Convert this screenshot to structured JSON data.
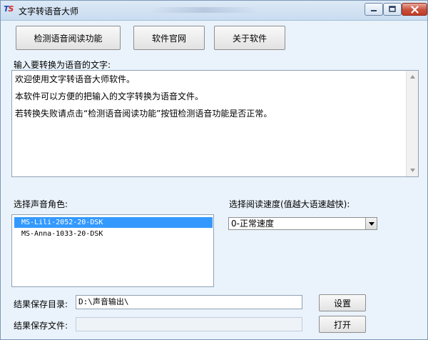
{
  "window": {
    "title": "文字转语音大师",
    "logo_text": "TS"
  },
  "toolbar": {
    "check_label": "检测语音阅读功能",
    "website_label": "软件官网",
    "about_label": "关于软件"
  },
  "input": {
    "label": "输入要转换为语音的文字:",
    "lines": [
      "欢迎使用文字转语音大师软件。",
      "本软件可以方便的把输入的文字转换为语音文件。",
      "若转换失败请点击“检测语音阅读功能”按钮检测语音功能是否正常。"
    ]
  },
  "voice": {
    "label": "选择声音角色:",
    "items": [
      "MS-Lili-2052-20-DSK",
      "MS-Anna-1033-20-DSK"
    ],
    "selected_index": 0
  },
  "speed": {
    "label": "选择阅读速度(值越大语速越快):",
    "selected": "0-正常速度"
  },
  "output": {
    "dir_label": "结果保存目录:",
    "dir_value": "D:\\声音输出\\",
    "file_label": "结果保存文件:",
    "file_value": "",
    "set_label": "设置",
    "open_label": "打开"
  },
  "icons": {
    "minimize": "minimize-icon",
    "maximize": "maximize-icon",
    "close": "close-icon",
    "dropdown": "chevron-down-icon"
  },
  "colors": {
    "window_bg": "#eaf3fb",
    "selection": "#3399ff",
    "close_button": "#c84f3b"
  }
}
